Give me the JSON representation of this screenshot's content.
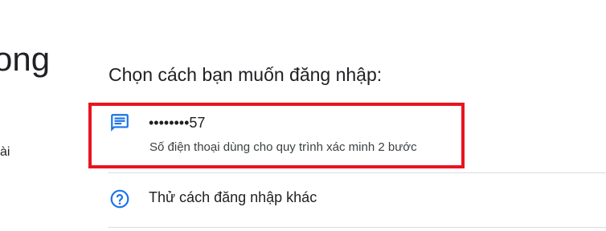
{
  "left_panel": {
    "heading_fragment": "ong",
    "subtext_fragment": "ài"
  },
  "prompt": "Chọn cách bạn muốn đăng nhập:",
  "options": [
    {
      "icon": "message-icon",
      "primary": "••••••••57",
      "secondary": "Số điện thoại dùng cho quy trình xác minh 2 bước"
    },
    {
      "icon": "help-circle-icon",
      "primary": "Thử cách đăng nhập khác"
    }
  ],
  "colors": {
    "accent": "#1a73e8",
    "highlight": "#e8141f",
    "divider": "#dadce0",
    "text": "#202124"
  }
}
